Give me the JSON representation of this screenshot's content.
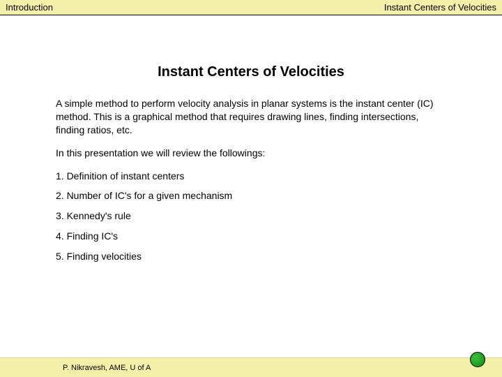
{
  "header": {
    "left": "Introduction",
    "right": "Instant Centers of Velocities"
  },
  "title": "Instant Centers of Velocities",
  "para1": "A simple method to perform velocity analysis in planar systems is the instant center (IC) method.  This is a graphical method that requires drawing lines, finding intersections, finding ratios, etc.",
  "para2": "In this presentation we will review the followings:",
  "items": {
    "i1": "1.  Definition of instant centers",
    "i2": "2.  Number of IC's for a given mechanism",
    "i3": "3.  Kennedy's rule",
    "i4": "4.  Finding IC's",
    "i5": "5.  Finding velocities"
  },
  "footer": {
    "author": "P. Nikravesh, AME, U of A"
  },
  "colors": {
    "banner": "#f5f0a9",
    "dot": "#0d8a0d"
  }
}
